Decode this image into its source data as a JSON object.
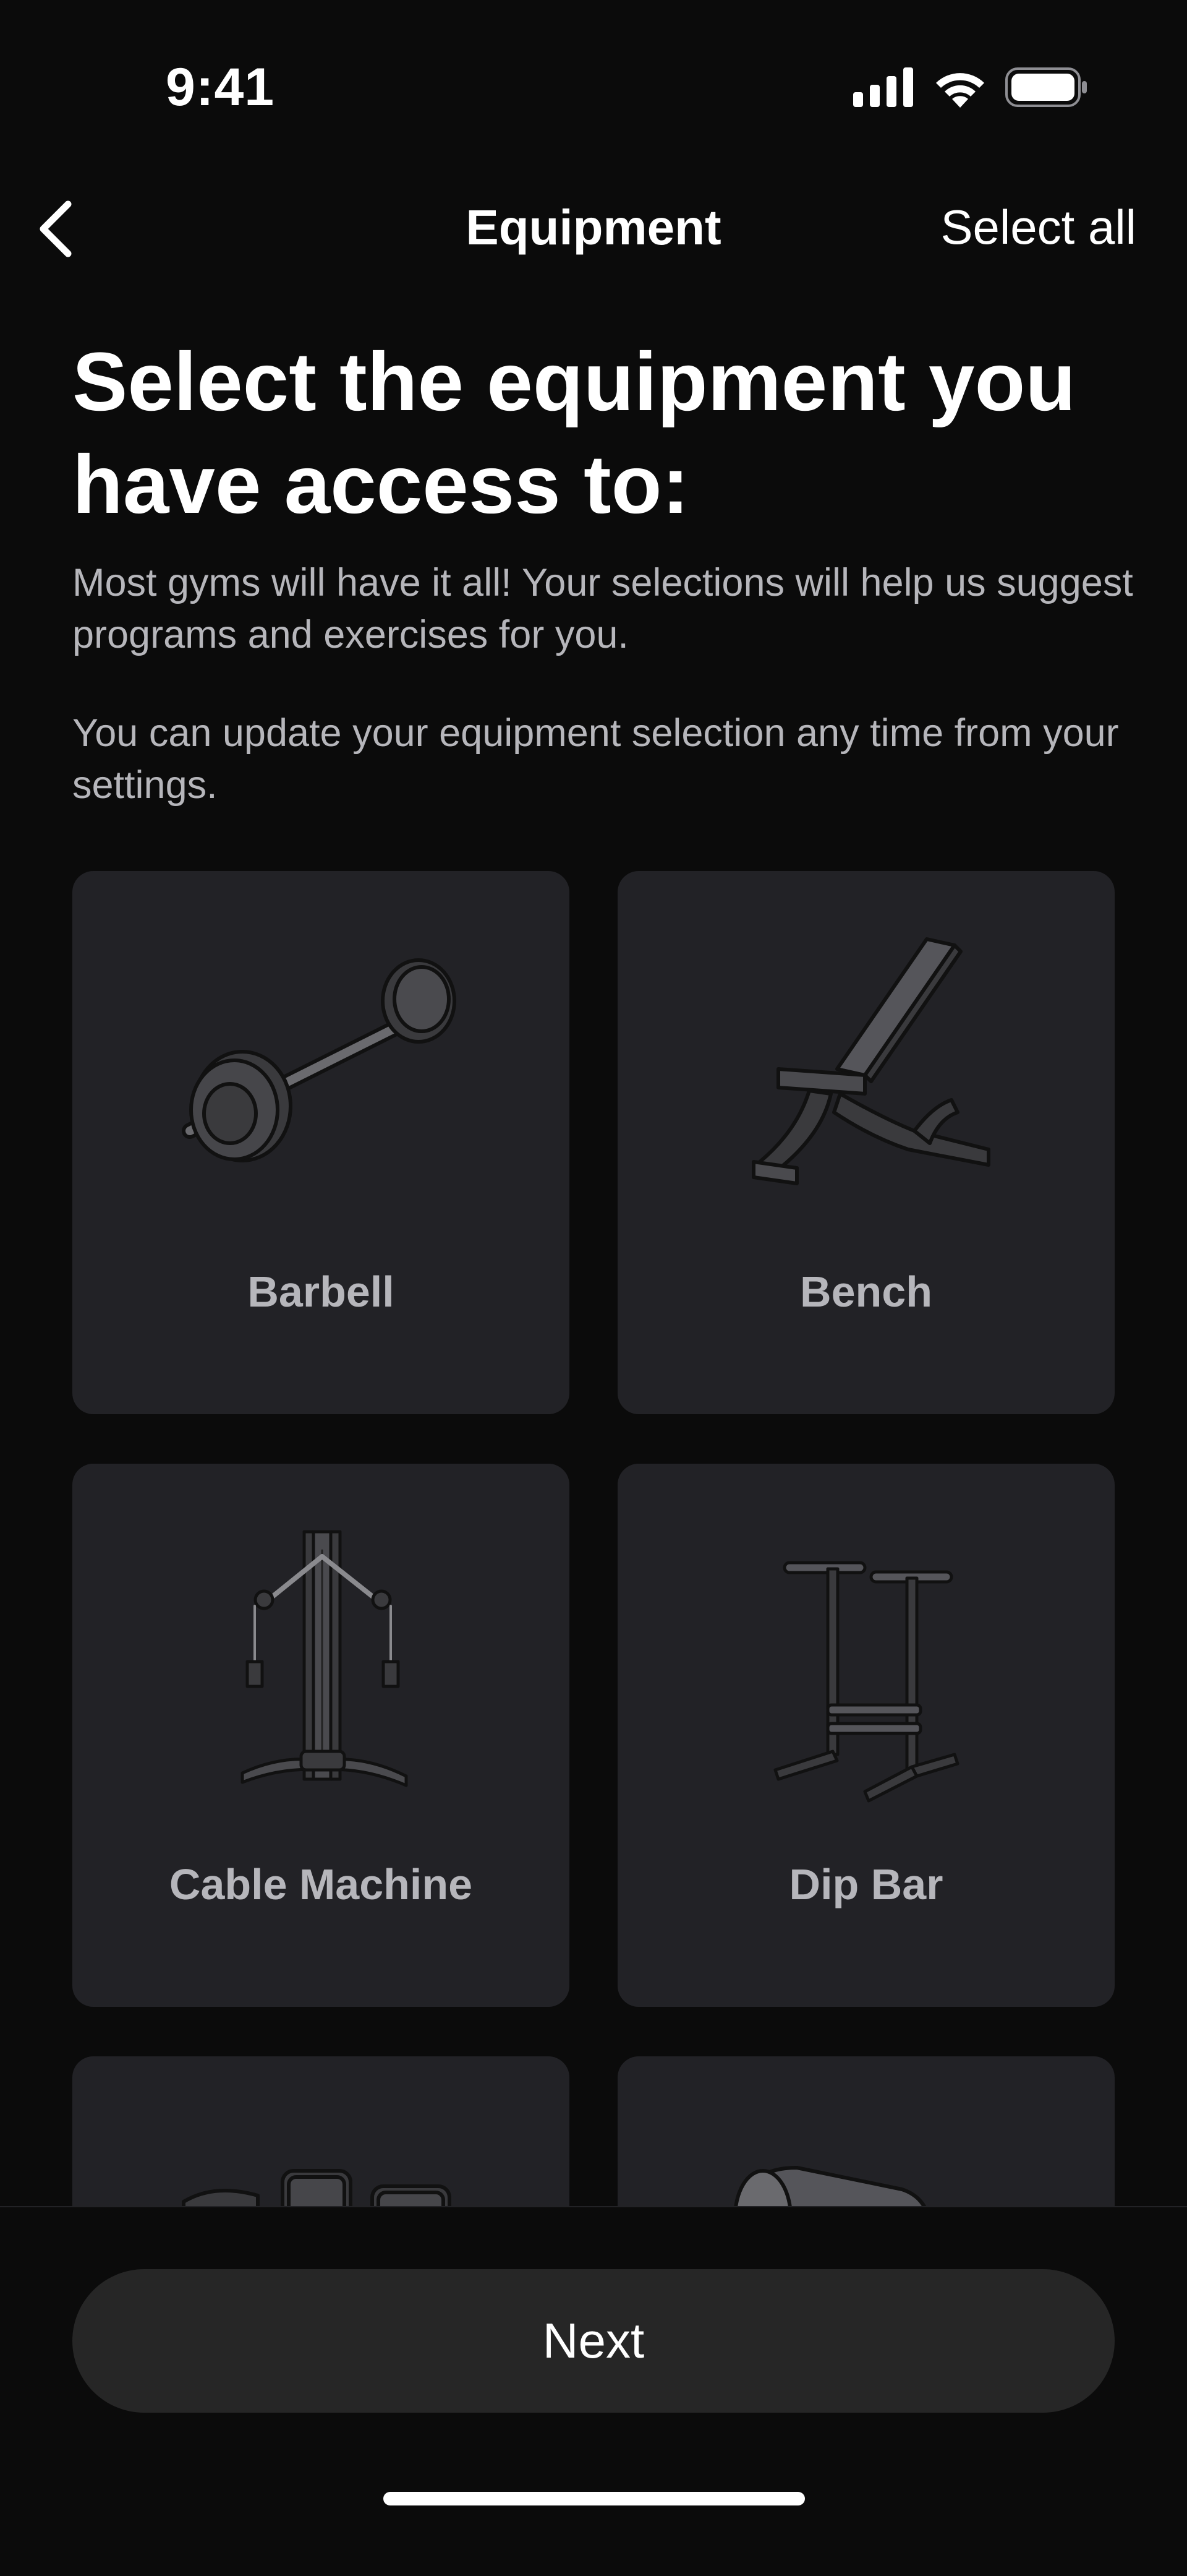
{
  "status_bar": {
    "time": "9:41",
    "icons": [
      "cellular-signal-icon",
      "wifi-icon",
      "battery-icon"
    ]
  },
  "nav": {
    "back_icon": "chevron-left-icon",
    "title": "Equipment",
    "select_all_label": "Select all"
  },
  "heading": "Select the equipment you have access to:",
  "subtext": [
    "Most gyms will have it all! Your selections will help us suggest programs and exercises for you.",
    "You can update your equipment selection any time from your settings."
  ],
  "equipment": [
    {
      "label": "Barbell",
      "icon": "barbell-icon"
    },
    {
      "label": "Bench",
      "icon": "bench-icon"
    },
    {
      "label": "Cable Machine",
      "icon": "cable-machine-icon"
    },
    {
      "label": "Dip Bar",
      "icon": "dip-bar-icon"
    },
    {
      "label": "",
      "icon": "dumbbells-icon"
    },
    {
      "label": "",
      "icon": "foam-roller-icon"
    }
  ],
  "footer": {
    "next_label": "Next"
  },
  "colors": {
    "background": "#0b0b0b",
    "card": "#222226",
    "button": "#262626",
    "secondary_text": "#b6b6bb",
    "primary_text": "#ffffff"
  }
}
